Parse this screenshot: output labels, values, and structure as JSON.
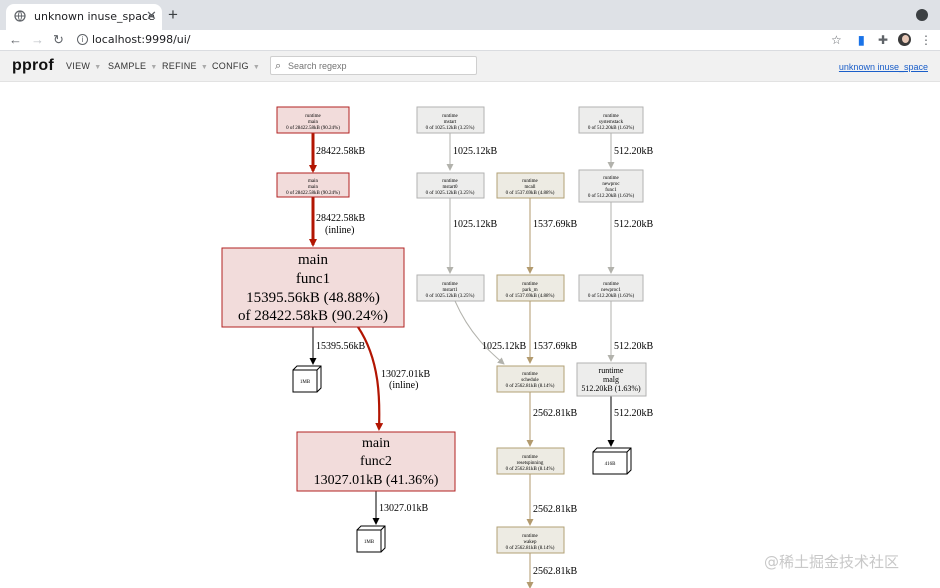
{
  "browser": {
    "tab_title": "unknown inuse_space",
    "url": "localhost:9998/ui/"
  },
  "app": {
    "brand": "pprof",
    "menus": [
      "VIEW",
      "SAMPLE",
      "REFINE",
      "CONFIG"
    ],
    "search_placeholder": "Search regexp",
    "profile_link": "unknown inuse_space"
  },
  "graph": {
    "nodes": {
      "runtime_main": [
        "runtime",
        "main",
        "0 of 28422.58kB (90.24%)"
      ],
      "main_main": [
        "main",
        "main",
        "0 of 28422.58kB (90.24%)"
      ],
      "main_func1": [
        "main",
        "func1",
        "15395.56kB (48.88%)",
        "of 28422.58kB (90.24%)"
      ],
      "main_func2": [
        "main",
        "func2",
        "13027.01kB (41.36%)"
      ],
      "rt_mstart": [
        "runtime",
        "mstart",
        "0 of 1025.12kB (3.25%)"
      ],
      "rt_mstart0": [
        "runtime",
        "mstart0",
        "0 of 1025.12kB (3.25%)"
      ],
      "rt_mstart1": [
        "runtime",
        "mstart1",
        "0 of 1025.12kB (3.25%)"
      ],
      "rt_mcall": [
        "runtime",
        "mcall",
        "0 of 1537.69kB (4.88%)"
      ],
      "rt_park_m": [
        "runtime",
        "park_m",
        "0 of 1537.69kB (4.88%)"
      ],
      "rt_schedule": [
        "runtime",
        "schedule",
        "0 of 2562.81kB (8.14%)"
      ],
      "rt_resetspinning": [
        "runtime",
        "resetspinning",
        "0 of 2562.81kB (8.14%)"
      ],
      "rt_wakep": [
        "runtime",
        "wakep",
        "0 of 2562.81kB (8.14%)"
      ],
      "rt_systemstack": [
        "runtime",
        "systemstack",
        "0 of 512.20kB (1.63%)"
      ],
      "rt_newproc_func1": [
        "runtime",
        "newproc",
        "func1",
        "0 of 512.20kB (1.63%)"
      ],
      "rt_newproc1": [
        "runtime",
        "newproc1",
        "0 of 512.20kB (1.63%)"
      ],
      "rt_malg": [
        "runtime",
        "malg",
        "512.20kB (1.63%)"
      ]
    },
    "leaves": {
      "func1_leaf": "1MB",
      "func2_leaf": "1MB",
      "malg_leaf": "416B"
    },
    "edges": {
      "e_rtmain_main": [
        "28422.58kB"
      ],
      "e_main_func1": [
        "28422.58kB",
        "(inline)"
      ],
      "e_func1_leaf": [
        "15395.56kB"
      ],
      "e_func1_func2": [
        "13027.01kB",
        "(inline)"
      ],
      "e_func2_leaf": [
        "13027.01kB"
      ],
      "e_mstart_mstart0": [
        "1025.12kB"
      ],
      "e_mstart0_mstart1": [
        "1025.12kB"
      ],
      "e_mcall_parkm": [
        "1537.69kB"
      ],
      "e_mstart1_schedule": [
        "1025.12kB"
      ],
      "e_parkm_schedule": [
        "1537.69kB"
      ],
      "e_schedule_reset": [
        "2562.81kB"
      ],
      "e_reset_wakep": [
        "2562.81kB"
      ],
      "e_wakep_out": [
        "2562.81kB"
      ],
      "e_sys_newproc": [
        "512.20kB"
      ],
      "e_newproc_newproc1": [
        "512.20kB"
      ],
      "e_newproc1_malg": [
        "512.20kB"
      ],
      "e_malg_leaf": [
        "512.20kB"
      ]
    }
  },
  "colors": {
    "hot_fill": "#f2dcdb",
    "hot_stroke": "#b22222",
    "hot_edge": "#b21502",
    "cold_fill": "#ededec",
    "cold_stroke": "#b2b2b2",
    "cold_edge": "#b2b2b2",
    "warm_fill": "#edebe3",
    "warm_stroke": "#b2a076",
    "warm_edge": "#b29a6e",
    "gray_edge": "#b2b2ac",
    "black_edge": "#000000"
  },
  "watermark": "@稀土掘金技术社区"
}
